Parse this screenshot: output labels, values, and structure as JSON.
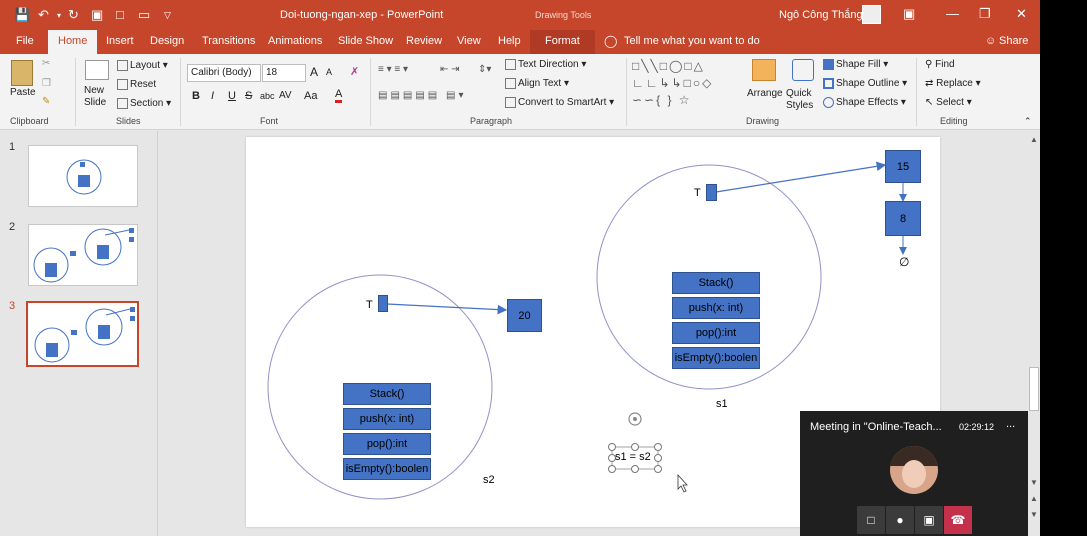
{
  "titlebar": {
    "doc_title": "Doi-tuong-ngan-xep  -  PowerPoint",
    "context_title": "Drawing Tools",
    "user_name": "Ngô Công Thắng"
  },
  "tabs": [
    "File",
    "Home",
    "Insert",
    "Design",
    "Transitions",
    "Animations",
    "Slide Show",
    "Review",
    "View",
    "Help",
    "Format"
  ],
  "active_tab": "Home",
  "tell_me": "Tell me what you want to do",
  "share_label": "Share",
  "ribbon": {
    "clipboard": {
      "label": "Clipboard",
      "paste": "Paste"
    },
    "slides": {
      "label": "Slides",
      "new_slide": "New\nSlide",
      "layout": "Layout",
      "reset": "Reset",
      "section": "Section"
    },
    "font": {
      "label": "Font",
      "font_name": "Calibri (Body)",
      "font_size": "18",
      "bold": "B",
      "italic": "I",
      "underline": "U",
      "strike": "S",
      "shadow": "abc",
      "spacing": "AV",
      "case": "Aa",
      "color": "A",
      "grow": "A",
      "shrink": "A"
    },
    "paragraph": {
      "label": "Paragraph",
      "text_direction": "Text Direction",
      "align_text": "Align Text",
      "smartart": "Convert to SmartArt"
    },
    "drawing": {
      "label": "Drawing",
      "arrange": "Arrange",
      "quick_styles": "Quick\nStyles",
      "shape_fill": "Shape Fill",
      "shape_outline": "Shape Outline",
      "shape_effects": "Shape Effects"
    },
    "editing": {
      "label": "Editing",
      "find": "Find",
      "replace": "Replace",
      "select": "Select"
    }
  },
  "slide_thumbs": [
    "1",
    "2",
    "3"
  ],
  "selected_slide": "3",
  "slide": {
    "s1": {
      "pointer_label": "T",
      "node_top": "15",
      "node_next": "8",
      "null_symbol": "∅",
      "methods": [
        "Stack()",
        "push(x: int)",
        "pop():int",
        "isEmpty():boolen"
      ],
      "name": "s1"
    },
    "s2": {
      "pointer_label": "T",
      "node_top": "20",
      "methods": [
        "Stack()",
        "push(x: int)",
        "pop():int",
        "isEmpty():boolen"
      ],
      "name": "s2"
    },
    "assign_text": "s1 = s2",
    "bottom_dots": ""
  },
  "meeting": {
    "title": "Meeting in \"Online-Teach...",
    "timer": "02:29:12",
    "more": "..."
  },
  "colors": {
    "accent": "#c6462b",
    "shape_fill": "#4472c4",
    "end_call": "#c4314b"
  }
}
